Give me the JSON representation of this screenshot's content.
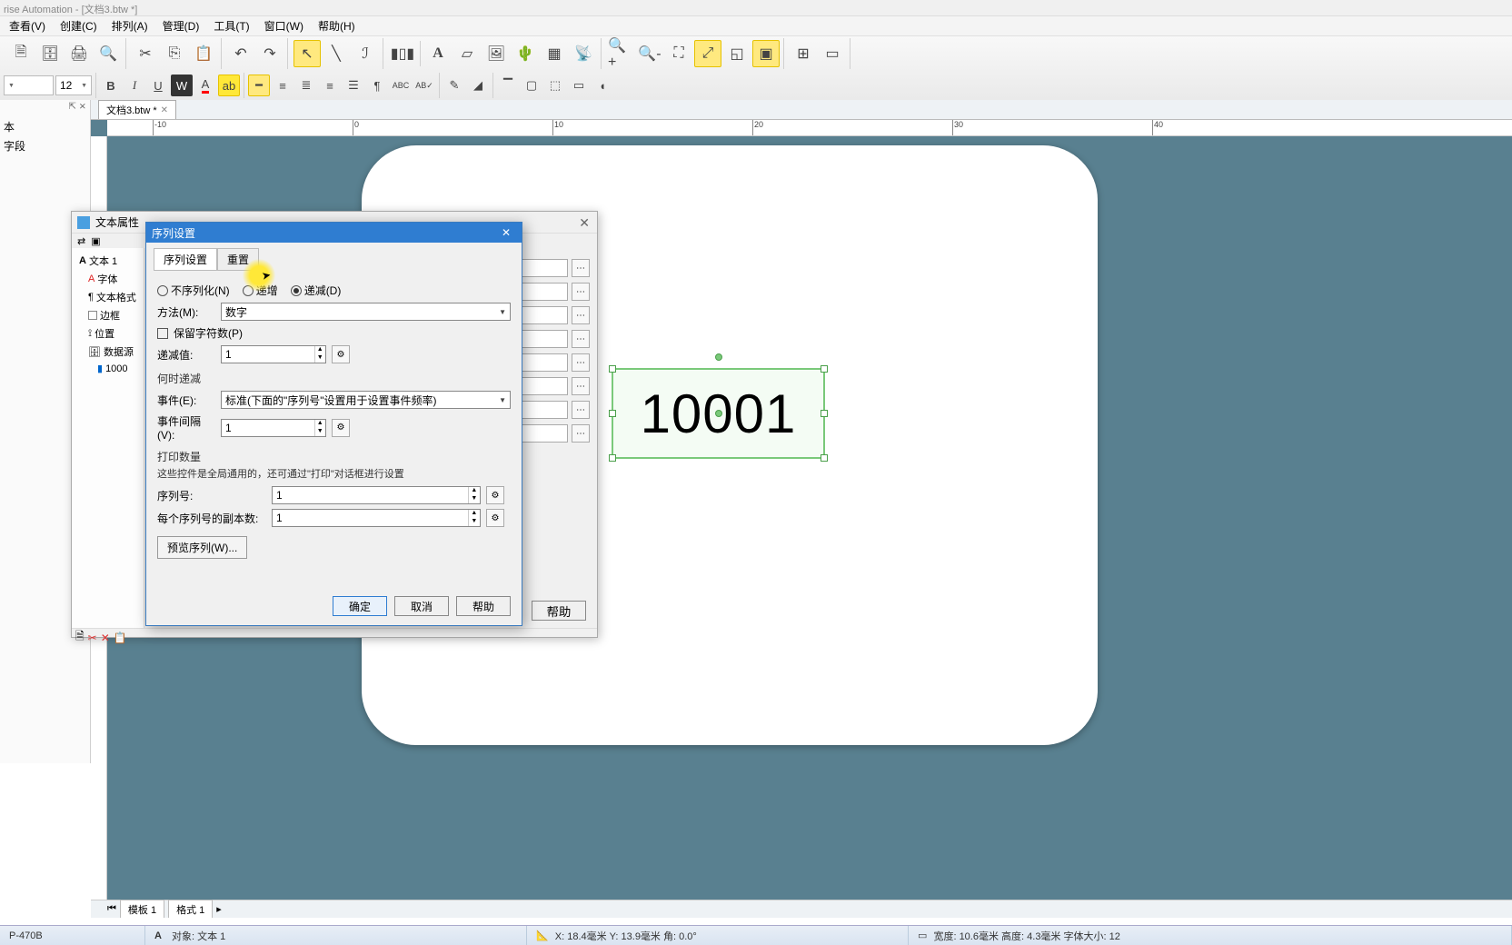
{
  "window": {
    "title": "rise Automation - [文档3.btw *]"
  },
  "menu": [
    "查看(V)",
    "创建(C)",
    "排列(A)",
    "管理(D)",
    "工具(T)",
    "窗口(W)",
    "帮助(H)"
  ],
  "toolbar": {
    "font_size": "12"
  },
  "panels": {
    "left_pin_label": "⇱ ⨯",
    "left_items": [
      "本",
      "字段"
    ]
  },
  "doc": {
    "tab": "文档3.btw *",
    "text_value": "10001",
    "bottom_tabs": [
      "模板 1",
      "格式 1"
    ],
    "ruler_marks": [
      "-10",
      "0",
      "10",
      "20",
      "30",
      "40"
    ]
  },
  "text_props": {
    "title": "文本属性",
    "tree_root": "文本 1",
    "tree": [
      "字体",
      "文本格式",
      "边框",
      "位置",
      "数据源"
    ],
    "tree_leaf": "1000",
    "help_btn": "帮助"
  },
  "seq": {
    "title": "序列设置",
    "tabs": [
      "序列设置",
      "重置"
    ],
    "radios": {
      "none": "不序列化(N)",
      "inc": "递增",
      "dec": "递减(D)",
      "selected": "dec"
    },
    "method_label": "方法(M):",
    "method_value": "数字",
    "keep_chars": "保留字符数(P)",
    "step_label": "递减值:",
    "step_value": "1",
    "when_title": "何时递减",
    "event_label": "事件(E):",
    "event_value": "标准(下面的\"序列号\"设置用于设置事件频率)",
    "interval_label": "事件间隔(V):",
    "interval_value": "1",
    "print_qty_title": "打印数量",
    "print_qty_note": "这些控件是全局通用的，还可通过\"打印\"对话框进行设置",
    "serial_label": "序列号:",
    "serial_value": "1",
    "copies_label": "每个序列号的副本数:",
    "copies_value": "1",
    "preview_btn": "预览序列(W)...",
    "ok": "确定",
    "cancel": "取消",
    "help": "帮助"
  },
  "status": {
    "printer": "P-470B",
    "object": "对象: 文本 1",
    "coords": "X: 18.4毫米  Y: 13.9毫米  角: 0.0°",
    "size": "宽度: 10.6毫米  高度: 4.3毫米  字体大小: 12"
  }
}
